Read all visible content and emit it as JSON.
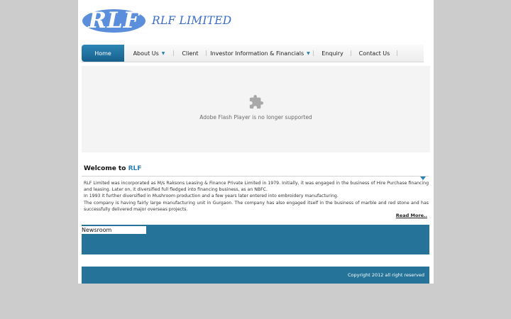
{
  "logo": {
    "mark": "RLF",
    "name": "RLF LIMITED"
  },
  "nav": {
    "items": [
      {
        "label": "Home"
      },
      {
        "label": "About Us"
      },
      {
        "label": "Client"
      },
      {
        "label": "Investor Information & Financials"
      },
      {
        "label": "Enquiry"
      },
      {
        "label": "Contact Us"
      }
    ]
  },
  "flash": {
    "message": "Adobe Flash Player is no longer supported",
    "icon": "puzzle-piece-icon"
  },
  "welcome": {
    "prefix": "Welcome to ",
    "brand": "RLF",
    "paragraphs": [
      "RLF Limited was incorporated as M/s Raksons Leasing & Finance Private Limited in 1979. Initially, it was engaged in the business of Hire Purchase financing and leasing. Later on, it diversified full fledged into financing business, as an NBFC.",
      "In 1993 it further diversified in Mushroom production and a few years later entered into embroidery manufacturing.",
      "The company is having fairly large manufacturing unit in Gurgaon. The company has also engaged itself in the business of marble and red stone and has successfully delivered major overseas projects."
    ],
    "read_more": "Read More.."
  },
  "newsroom": {
    "title": "Newsroom"
  },
  "footer": {
    "copyright": "Copyright 2012 all right reserved"
  },
  "colors": {
    "accent": "#2a7fb4",
    "band": "#257399",
    "logo": "#5b8fdc",
    "background": "#cccccc"
  }
}
